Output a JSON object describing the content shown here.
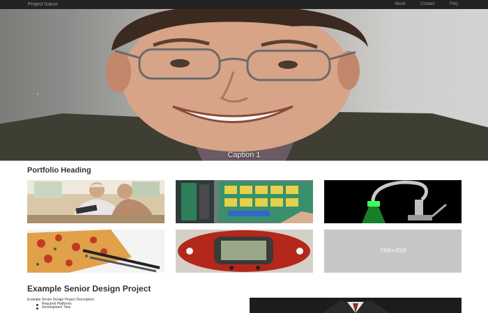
{
  "navbar": {
    "brand": "Project Icarus",
    "links": [
      "About",
      "Contact",
      "FAQ"
    ]
  },
  "carousel": {
    "caption": "Caption 1",
    "indicator_count": 3,
    "active_index": 0
  },
  "portfolio": {
    "heading": "Portfolio Heading",
    "placeholder_label": "700×450"
  },
  "example": {
    "heading": "Example Senior Design Project",
    "description": "Example Senior Design Project Description:",
    "bullets": [
      "Required Platforms",
      "Development Time"
    ]
  },
  "colors": {
    "navbar_bg": "#222222",
    "nav_text": "#9d9d9d",
    "placeholder_bg": "#c6c6c6"
  }
}
